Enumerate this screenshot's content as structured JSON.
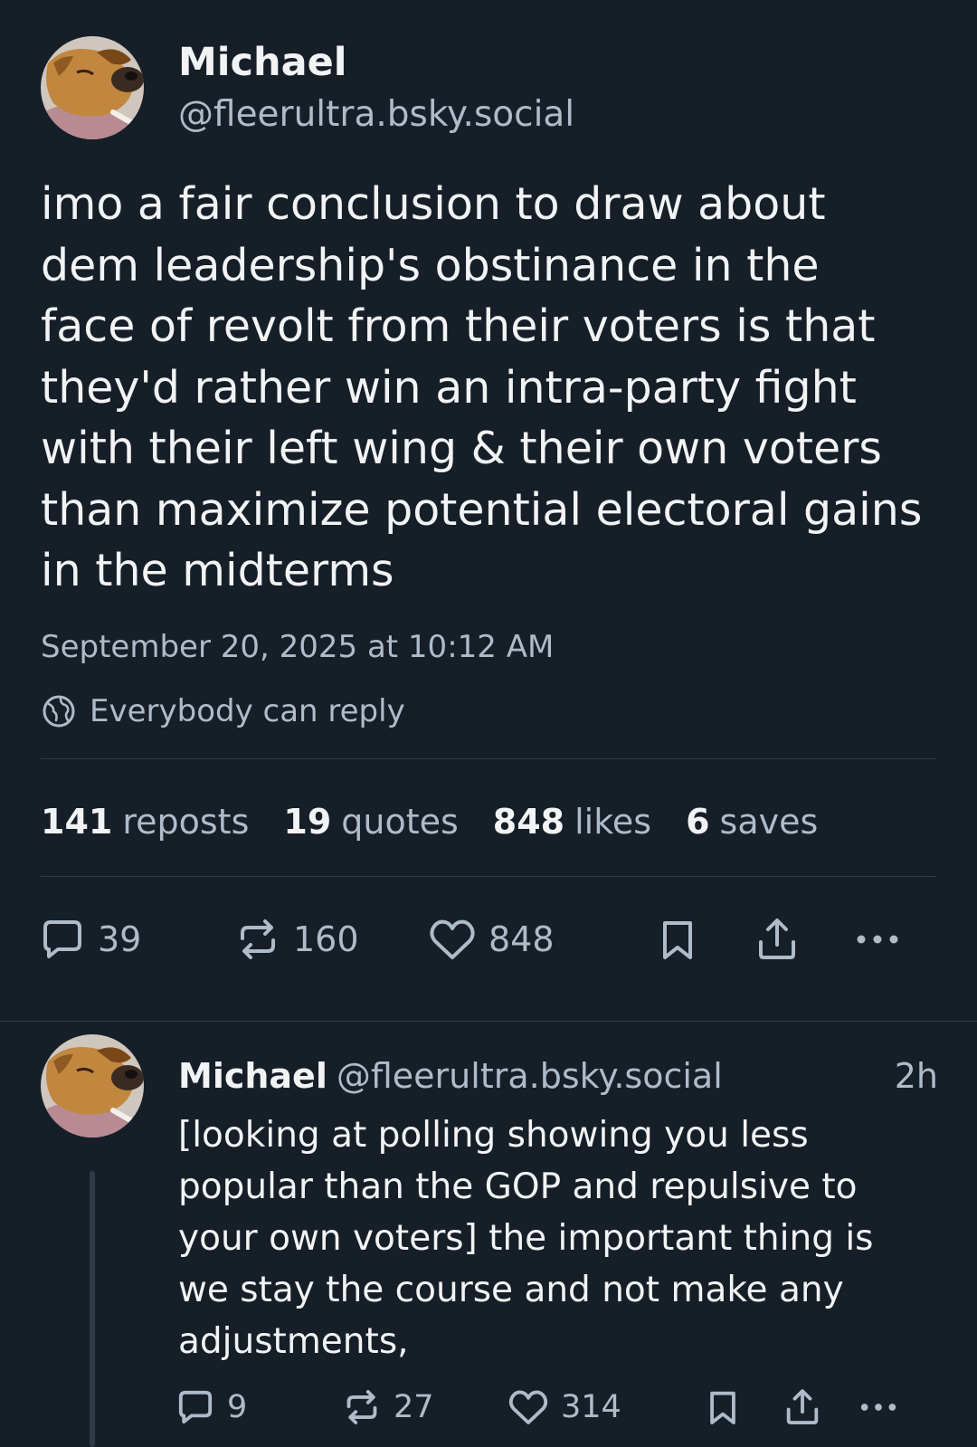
{
  "post": {
    "author_name": "Michael",
    "author_handle": "@fleerultra.bsky.social",
    "text_lines": [
      "imo a fair conclusion to draw about",
      "dem leadership's obstinance in the",
      "face of revolt from their voters is that",
      "they'd rather win an intra-party fight",
      "with their left wing & their own voters",
      "than maximize potential electoral gains",
      "in the midterms"
    ],
    "timestamp": "September 20, 2025 at 10:12 AM",
    "reply_setting": "Everybody can reply",
    "stats": {
      "reposts_count": "141",
      "reposts_label": "reposts",
      "quotes_count": "19",
      "quotes_label": "quotes",
      "likes_count": "848",
      "likes_label": "likes",
      "saves_count": "6",
      "saves_label": "saves"
    },
    "actions": {
      "reply_count": "39",
      "repost_count": "160",
      "like_count": "848"
    }
  },
  "reply": {
    "author_name": "Michael",
    "author_handle": "@fleerultra.bsky.social",
    "time_ago": "2h",
    "text_lines": [
      "[looking at polling showing you less",
      "popular than the GOP and repulsive to",
      "your own voters] the important thing is",
      "we stay the course and not make any",
      "adjustments,"
    ],
    "actions": {
      "reply_count": "9",
      "repost_count": "27",
      "like_count": "314"
    }
  },
  "icons": {
    "reply": "speech-bubble-icon",
    "repost": "repost-arrows-icon",
    "like": "heart-icon",
    "save": "bookmark-icon",
    "share": "share-upload-icon",
    "more": "ellipsis-icon",
    "reply_setting": "globe-icon"
  },
  "colors": {
    "background": "#161e27",
    "text_primary": "#f1f3f5",
    "text_secondary": "#aebbc9",
    "divider": "#2e3a47"
  }
}
